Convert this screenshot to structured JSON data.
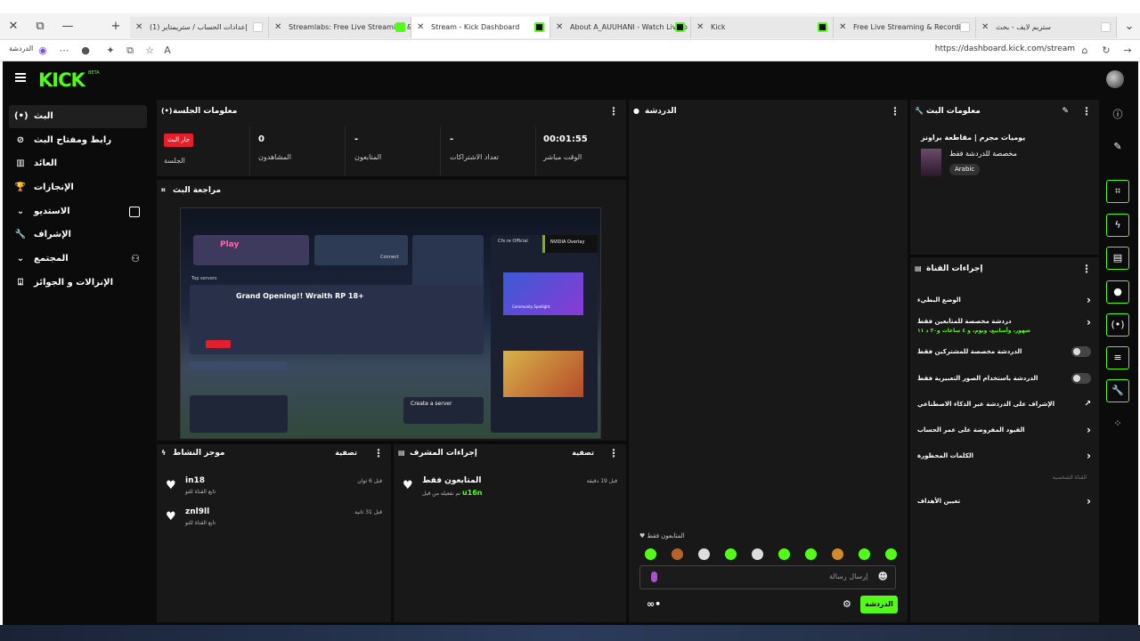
{
  "browser": {
    "window_buttons": [
      "✕",
      "—",
      "⧉"
    ],
    "new_tab": "+",
    "tabs": [
      {
        "title": "(1) إعدادات الحساب / ستريمتاير"
      },
      {
        "title": "Streamlabs: Free Live Streaming &"
      },
      {
        "title": "Stream - Kick Dashboard"
      },
      {
        "title": "About A_AUUHANI - Watch Live o"
      },
      {
        "title": "Kick"
      },
      {
        "title": "Free Live Streaming & Recording"
      },
      {
        "title": "ستريم لايف - بحث"
      }
    ],
    "url": "https://dashboard.kick.com/stream",
    "profile_label": "الدردشة"
  },
  "app": {
    "logo": "KICK",
    "logo_badge": "BETA",
    "accent": "#53fc18",
    "sidebar": [
      {
        "label": "البث",
        "icon": "(•)"
      },
      {
        "label": "رابط ومفتاح البث",
        "icon": "⊘"
      },
      {
        "label": "العائد",
        "icon": "▥"
      },
      {
        "label": "الإنجازات",
        "icon": "🏆"
      },
      {
        "label": "الاستديو",
        "icon": "⌄"
      },
      {
        "label": "الإشراف",
        "icon": "🔧"
      },
      {
        "label": "المجتمع",
        "icon": "⌄"
      },
      {
        "label": "الإنزالات و الجوائز",
        "icon": "⍗"
      }
    ],
    "session": {
      "title": "معلومات الجلسة",
      "live_badge": "جار البث",
      "session_label": "الجلسة",
      "viewers_value": "0",
      "viewers_label": "المشاهدون",
      "followers_value": "-",
      "followers_label": "المتابعون",
      "subs_value": "-",
      "subs_label": "تعداد الاشتراكات",
      "time_value": "00:01:55",
      "time_label": "الوقت مباشر"
    },
    "preview": {
      "title": "مراجعة البث",
      "game_title": "Grand Opening!! Wraith RP 18+",
      "play_label": "Play",
      "connect_label": "Connect",
      "create_server": "Create a server",
      "top_servers": "Top servers",
      "news_label": "Cfx.re Official",
      "nvidia_label": "NVIDIA Overlay",
      "community_label": "Community Spotlight"
    },
    "activity": {
      "title": "موجز النشاط",
      "filter_label": "تصفية",
      "items": [
        {
          "name": "in18",
          "sub": "تابع القناة للتو",
          "time": "قبل 6 ثوان"
        },
        {
          "name": "znl9ll",
          "sub": "تابع القناة للتو",
          "time": "قبل 31 ثانية"
        }
      ]
    },
    "mod_actions": {
      "title": "إجراءات المشرف",
      "filter_label": "تصفية",
      "items": [
        {
          "name": "المتابعون فقط",
          "sub": "تم تفعيله من قبل",
          "by": "u16n",
          "time": "قبل 19 دقيقة"
        }
      ]
    },
    "chat": {
      "title": "الدردشة",
      "followers_only": "المتابعون فقط",
      "placeholder": "إرسال رسالة",
      "send_label": "الدردشة"
    },
    "stream_info": {
      "title": "معلومات البث",
      "stream_title": "يوميات مجرم | مقاطعة براونز",
      "category": "مخصصة للدردشة فقط",
      "language": "Arabic"
    },
    "channel_actions": {
      "title": "إجراءات القناة",
      "slow_mode": "الوضع البطيء",
      "followers_chat": "دردشة مخصصة للمتابعين فقط",
      "followers_chat_sub": "شهور، وأسابيع، ويوم، و ٤ ساعات و٣٠ د ١١",
      "subs_only": "الدردشة مخصصة للمشتركين فقط",
      "emotes_only": "الدردشة باستخدام الصور التعبيرية فقط",
      "ai_mod": "الإشراف على الدردشة عبر الذكاء الاصطناعي",
      "account_age": "القيود المفروضة على عمر الحساب",
      "banned_words": "الكلمات المحظورة",
      "custom_channel": "القناة الشخصية",
      "set_goals": "تعيين الأهداف"
    },
    "rail_icons": [
      "info-icon",
      "pencil-icon",
      "focus-icon",
      "bolt-icon",
      "doc-icon",
      "chat-icon",
      "broadcast-icon",
      "layers-icon",
      "wrench-icon",
      "apps-icon"
    ]
  }
}
